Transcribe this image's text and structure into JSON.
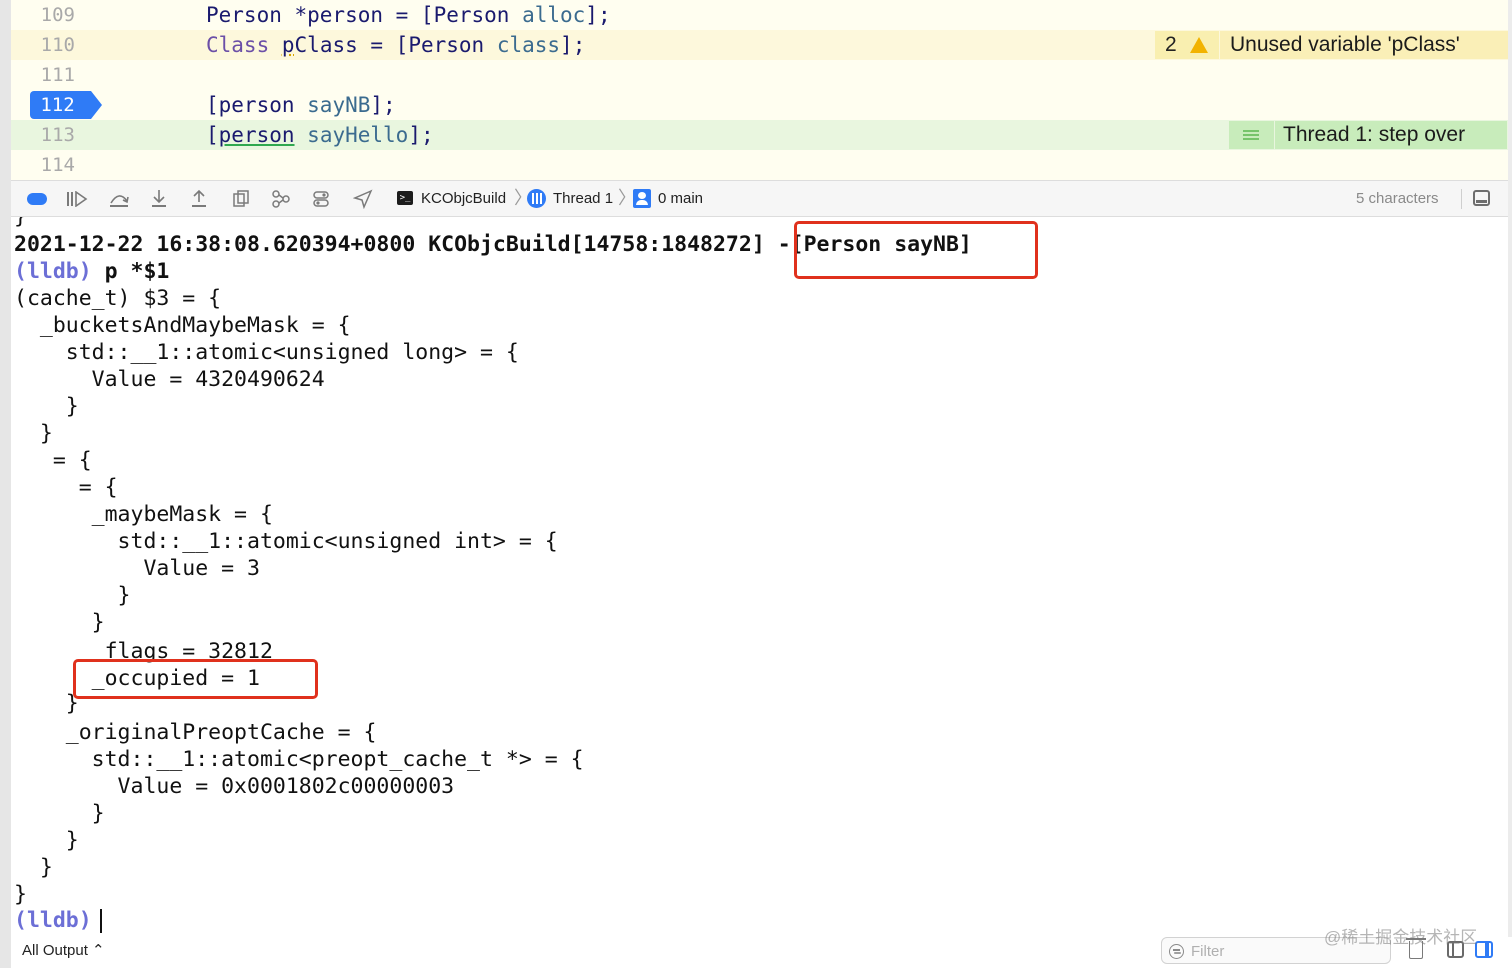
{
  "editor": {
    "lines": [
      {
        "num": "109",
        "code": "Person *person = [Person alloc];"
      },
      {
        "num": "110",
        "code": "Class pClass = [Person class];"
      },
      {
        "num": "111",
        "code": ""
      },
      {
        "num": "112",
        "code": "[person sayNB];"
      },
      {
        "num": "113",
        "code": "[person sayHello];"
      },
      {
        "num": "114",
        "code": ""
      }
    ],
    "breakpoint_line": "112",
    "warning": {
      "count": "2",
      "message": "Unused variable 'pClass'"
    },
    "step": {
      "message": "Thread 1: step over"
    }
  },
  "debug_bar": {
    "crumbs": {
      "target": "KCObjcBuild",
      "thread": "Thread 1",
      "frame": "0 main"
    },
    "char_count": "5 characters"
  },
  "console": {
    "top_fragment": "}",
    "log_line": "2021-12-22 16:38:08.620394+0800 KCObjcBuild[14758:1848272] ",
    "log_method": "-[Person sayNB]",
    "prompt": "(lldb)",
    "command": " p *$1",
    "lines": [
      "(cache_t) $3 = {",
      "  _bucketsAndMaybeMask = {",
      "    std::__1::atomic<unsigned long> = {",
      "      Value = 4320490624",
      "    }",
      "  }",
      "   = {",
      "     = {",
      "      _maybeMask = {",
      "        std::__1::atomic<unsigned int> = {",
      "          Value = 3",
      "        }",
      "      }",
      "       flags = 32812",
      "      _occupied = 1",
      "    }",
      "    _originalPreoptCache = {",
      "      std::__1::atomic<preopt_cache_t *> = {",
      "        Value = 0x0001802c00000003",
      "      }",
      "    }",
      "  }",
      "}"
    ],
    "final_prompt": "(lldb)"
  },
  "bottom_bar": {
    "output_selector": "All Output ⌃",
    "filter_placeholder": "Filter",
    "watermark": "@稀土掘金技术社区"
  },
  "colors": {
    "breakpoint": "#2f7bf6",
    "warning_bg": "#faefb7",
    "step_bg": "#c8ecbb",
    "highlight_box": "#e0311d",
    "lldb_prompt": "#6c6fd6"
  }
}
